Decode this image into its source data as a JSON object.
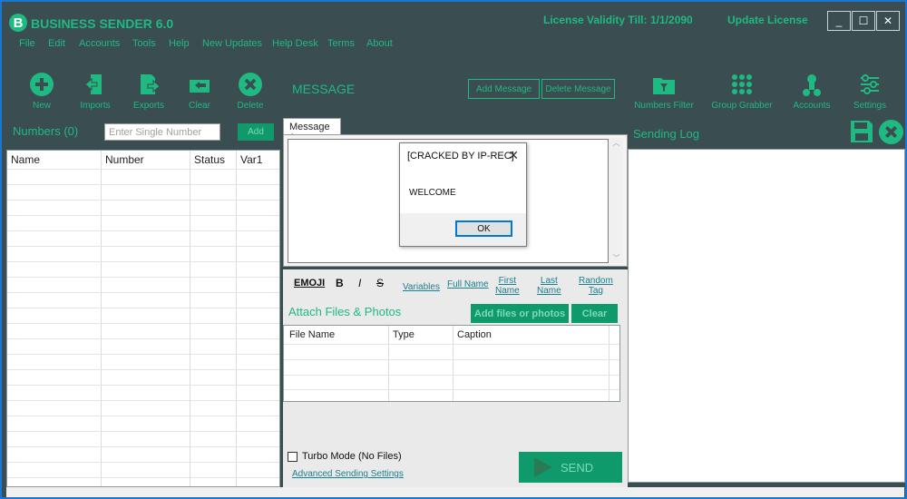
{
  "app": {
    "logo_letter": "B",
    "title": "BUSINESS SENDER 6.0",
    "license_label": "License Validity Till:",
    "license_date": "1/1/2090",
    "update_license": "Update License",
    "window": {
      "minimize": "_",
      "maximize": "☐",
      "close": "✕"
    }
  },
  "menu": [
    "File",
    "Edit",
    "Accounts",
    "Tools",
    "Help",
    "New Updates",
    "Help Desk",
    "Terms",
    "About"
  ],
  "toolbar": {
    "new": "New",
    "imports": "Imports",
    "exports": "Exports",
    "clear": "Clear",
    "delete": "Delete",
    "message_label": "MESSAGE",
    "add_message": "Add Message",
    "delete_message": "Delete Message",
    "numbers_filter": "Numbers Filter",
    "group_grabber": "Group Grabber",
    "accounts": "Accounts",
    "settings": "Settings"
  },
  "left_panel": {
    "numbers_label": "Numbers (0)",
    "single_number_placeholder": "Enter Single Number",
    "add_button": "Add",
    "columns": [
      "Name",
      "Number",
      "Status",
      "Var1"
    ]
  },
  "message": {
    "tab_label": "Message 1",
    "format": {
      "emoji": "EMOJI",
      "bold": "B",
      "italic": "I",
      "strike": "S",
      "variables": "Variables",
      "full_name": "Full Name",
      "first_name_1": "First",
      "first_name_2": "Name",
      "last_name_1": "Last",
      "last_name_2": "Name",
      "random_tag_1": "Random",
      "random_tag_2": "Tag"
    },
    "attach_label": "Attach Files & Photos",
    "add_files_button": "Add files or photos",
    "clear_button": "Clear",
    "file_columns": [
      "File Name",
      "Type",
      "Caption"
    ],
    "turbo_mode": "Turbo Mode (No Files)",
    "advanced_settings": "Advanced Sending Settings",
    "send_button": "SEND"
  },
  "right_panel": {
    "sending_log": "Sending Log"
  },
  "dialog": {
    "title": "[CRACKED BY IP-REC]",
    "message": "WELCOME",
    "ok": "OK"
  },
  "colors": {
    "background": "#3a4d50",
    "accent": "#1fb982",
    "button_fill": "#0f9a6c",
    "link": "#1a7f8e"
  },
  "icons": [
    "plus-circle-icon",
    "import-icon",
    "export-icon",
    "clear-icon",
    "delete-icon",
    "folder-filter-icon",
    "grid-dots-icon",
    "accounts-icon",
    "settings-sliders-icon",
    "save-icon",
    "close-circle-icon",
    "send-arrow-icon"
  ]
}
